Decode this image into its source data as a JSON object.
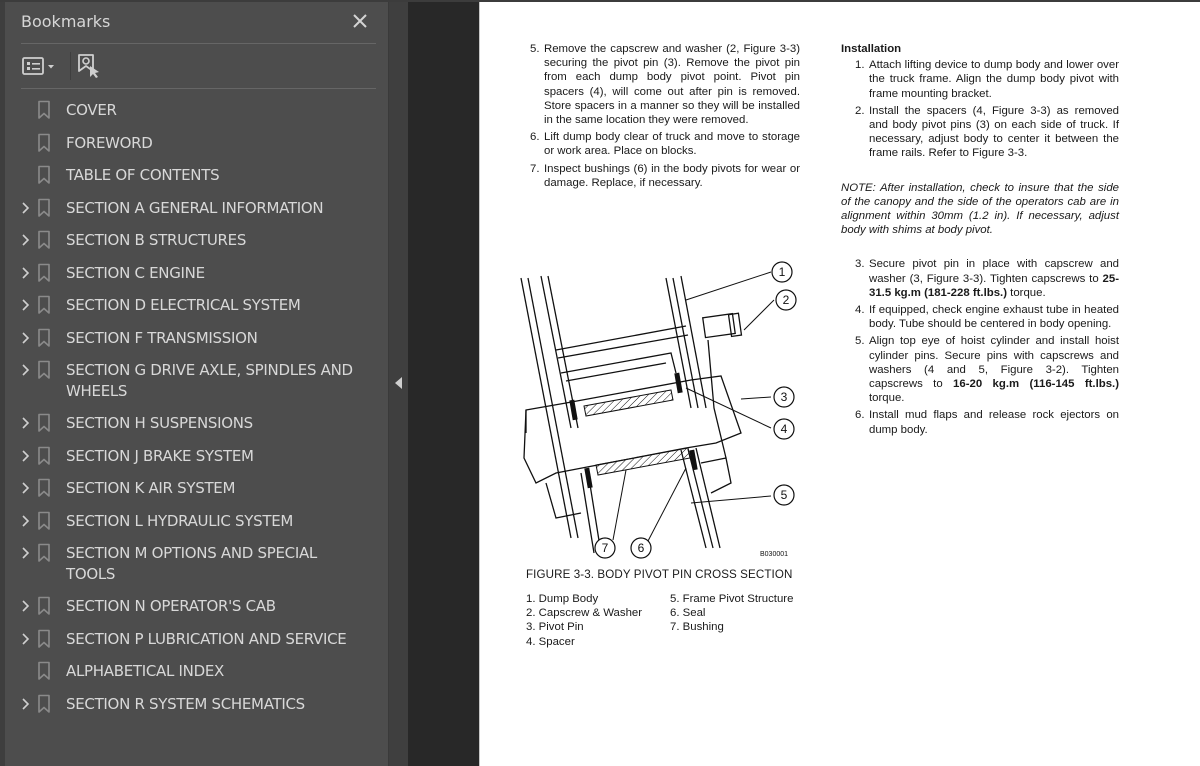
{
  "panel": {
    "title": "Bookmarks",
    "close_icon": "close-icon",
    "toolbar": {
      "options_icon": "list-options-icon",
      "new_bookmark_icon": "add-bookmark-icon"
    },
    "bookmarks": [
      {
        "label": "COVER",
        "expandable": false
      },
      {
        "label": "FOREWORD",
        "expandable": false
      },
      {
        "label": "TABLE OF CONTENTS",
        "expandable": false
      },
      {
        "label": "SECTION A GENERAL INFORMATION",
        "expandable": true
      },
      {
        "label": "SECTION B STRUCTURES",
        "expandable": true
      },
      {
        "label": "SECTION C ENGINE",
        "expandable": true
      },
      {
        "label": "SECTION D ELECTRICAL SYSTEM",
        "expandable": true
      },
      {
        "label": "SECTION F TRANSMISSION",
        "expandable": true
      },
      {
        "label": "SECTION G DRIVE AXLE, SPINDLES AND WHEELS",
        "expandable": true
      },
      {
        "label": "SECTION H SUSPENSIONS",
        "expandable": true
      },
      {
        "label": "SECTION J BRAKE SYSTEM",
        "expandable": true
      },
      {
        "label": "SECTION K AIR SYSTEM",
        "expandable": true
      },
      {
        "label": "SECTION L HYDRAULIC SYSTEM",
        "expandable": true
      },
      {
        "label": "SECTION M OPTIONS AND SPECIAL TOOLS",
        "expandable": true
      },
      {
        "label": "SECTION N  OPERATOR'S CAB",
        "expandable": true
      },
      {
        "label": "SECTION P LUBRICATION AND SERVICE",
        "expandable": true
      },
      {
        "label": "ALPHABETICAL INDEX",
        "expandable": false
      },
      {
        "label": "SECTION R SYSTEM SCHEMATICS",
        "expandable": true
      }
    ]
  },
  "document": {
    "left_steps": [
      {
        "num": "5.",
        "text": "Remove the capscrew and washer (2, Figure 3-3) securing the pivot pin (3). Remove the pivot pin from each dump body pivot point. Pivot pin spacers (4), will come out after pin is removed. Store spacers in a manner so they will be installed in the same location they were removed."
      },
      {
        "num": "6.",
        "text": "Lift dump body clear of truck and move to storage or work area. Place on blocks."
      },
      {
        "num": "7.",
        "text": "Inspect bushings (6) in the body pivots for wear or damage. Replace, if necessary."
      }
    ],
    "installation_heading": "Installation",
    "install_steps_a": [
      {
        "num": "1.",
        "text": "Attach lifting device to dump body and lower over the truck frame. Align the dump body pivot with frame mounting bracket."
      },
      {
        "num": "2.",
        "text": "Install the spacers (4, Figure 3-3) as removed and body pivot pins (3) on each side of truck. If necessary, adjust body to center it between the frame rails. Refer to Figure 3-3."
      }
    ],
    "note": "NOTE: After installation, check to insure that the side of the canopy and the side of the operators cab are in alignment within 30mm (1.2 in). If necessary, adjust body with shims at body pivot.",
    "install_steps_b": [
      {
        "num": "3.",
        "pre": "Secure pivot pin in place with capscrew and washer (3, Figure 3-3). Tighten capscrews to ",
        "bold": "25-31.5 kg.m (181-228 ft.lbs.)",
        "post": " torque."
      },
      {
        "num": "4.",
        "pre": "If equipped, check engine exhaust tube in heated body. Tube should be centered in body opening.",
        "bold": "",
        "post": ""
      },
      {
        "num": "5.",
        "pre": "Align top eye of hoist cylinder and install hoist cylinder pins. Secure pins with capscrews and washers (4 and 5, Figure 3-2). Tighten capscrews to ",
        "bold": "16-20 kg.m (116-145 ft.lbs.)",
        "post": " torque."
      },
      {
        "num": "6.",
        "pre": "Install mud flaps and release rock ejectors on dump body.",
        "bold": "",
        "post": ""
      }
    ],
    "figure": {
      "callouts": [
        "1",
        "2",
        "3",
        "4",
        "5",
        "6",
        "7"
      ],
      "code": "B030001",
      "caption": "FIGURE 3-3. BODY PIVOT PIN CROSS SECTION",
      "legend": [
        "1. Dump Body",
        "5. Frame Pivot Structure",
        "2. Capscrew & Washer",
        "6. Seal",
        "3. Pivot Pin",
        "7. Bushing",
        "4. Spacer",
        ""
      ]
    }
  }
}
